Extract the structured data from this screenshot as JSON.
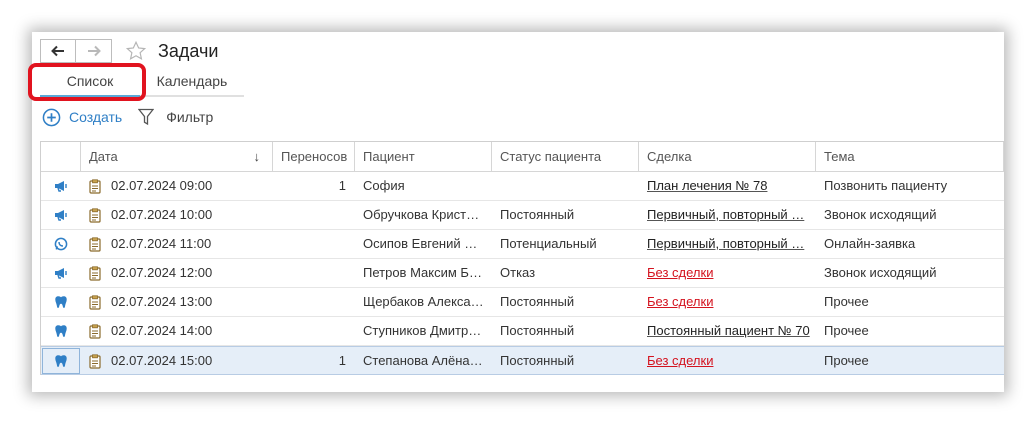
{
  "header": {
    "back_icon": "arrow-left-icon",
    "forward_icon": "arrow-right-icon",
    "favorite_icon": "star-icon",
    "title": "Задачи"
  },
  "tabs": [
    {
      "label": "Список",
      "active": true
    },
    {
      "label": "Календарь",
      "active": false
    }
  ],
  "toolbar": {
    "create_label": "Создать",
    "filter_label": "Фильтр"
  },
  "colors": {
    "accent": "#2f7fc6",
    "highlight_frame": "#e1131f",
    "red_link": "#d4131f",
    "selected_row": "#e5eef8"
  },
  "table": {
    "columns": [
      "",
      "Дата",
      "Переносов",
      "Пациент",
      "Статус пациента",
      "Сделка",
      "Тема"
    ],
    "sort_indicator": "↓",
    "rows": [
      {
        "type_icon": "megaphone-icon",
        "date": "02.07.2024 09:00",
        "transfers": "1",
        "patient": "София",
        "status": "",
        "deal": "План лечения № 78",
        "deal_red": false,
        "topic": "Позвонить пациенту"
      },
      {
        "type_icon": "megaphone-icon",
        "date": "02.07.2024 10:00",
        "transfers": "",
        "patient": "Обручкова Крист…",
        "status": "Постоянный",
        "deal": "Первичный, повторный …",
        "deal_red": false,
        "topic": "Звонок исходящий"
      },
      {
        "type_icon": "whatsapp-icon",
        "date": "02.07.2024 11:00",
        "transfers": "",
        "patient": "Осипов Евгений …",
        "status": "Потенциальный",
        "deal": "Первичный, повторный …",
        "deal_red": false,
        "topic": "Онлайн-заявка"
      },
      {
        "type_icon": "megaphone-icon",
        "date": "02.07.2024 12:00",
        "transfers": "",
        "patient": "Петров Максим Б…",
        "status": "Отказ",
        "deal": "Без сделки",
        "deal_red": true,
        "topic": "Звонок исходящий"
      },
      {
        "type_icon": "tooth-icon",
        "date": "02.07.2024 13:00",
        "transfers": "",
        "patient": "Щербаков Алекса…",
        "status": "Постоянный",
        "deal": "Без сделки",
        "deal_red": true,
        "topic": "Прочее"
      },
      {
        "type_icon": "tooth-icon",
        "date": "02.07.2024 14:00",
        "transfers": "",
        "patient": "Ступников Дмитр…",
        "status": "Постоянный",
        "deal": "Постоянный пациент № 70",
        "deal_red": false,
        "topic": "Прочее"
      },
      {
        "type_icon": "tooth-icon",
        "date": "02.07.2024 15:00",
        "transfers": "1",
        "patient": "Степанова Алёна…",
        "status": "Постоянный",
        "deal": "Без сделки",
        "deal_red": true,
        "topic": "Прочее",
        "selected": true
      }
    ]
  }
}
